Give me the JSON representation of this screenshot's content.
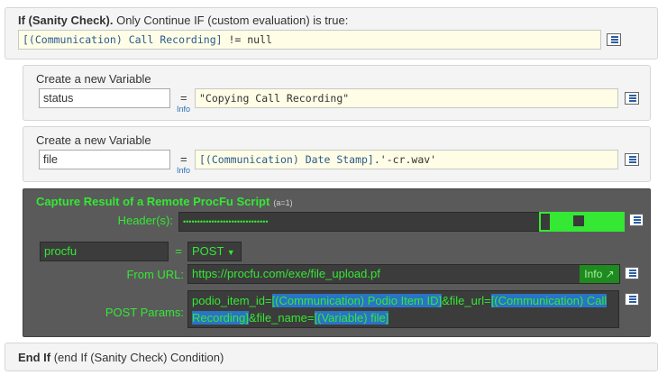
{
  "sanity_check": {
    "title_bold": "If (Sanity Check).",
    "title_rest": " Only Continue IF (custom evaluation) is true:",
    "expression_var": "[(Communication) Call Recording]",
    "expression_rest": " != null"
  },
  "var1": {
    "title": "Create a new Variable",
    "name": "status",
    "eq": "=",
    "info": "Info",
    "value": "\"Copying Call Recording\""
  },
  "var2": {
    "title": "Create a new Variable",
    "name": "file",
    "eq": "=",
    "info": "Info",
    "value_var": "[(Communication) Date Stamp]",
    "value_rest": ".'-cr.wav'"
  },
  "capture": {
    "title": "Capture Result of a Remote ProcFu Script",
    "badge": "(a=1)",
    "headers_label": "Header(s):",
    "headers_value": "••••••••••••••••••••••••••••••",
    "result_var": "procfu",
    "eq": "=",
    "method": "POST",
    "method_arrow": "▼",
    "url_label": "From URL:",
    "url_value": "https://procfu.com/exe/file_upload.pf",
    "url_info": "Info ↗",
    "params_label": "POST Params:",
    "params": {
      "p1": "podio_item_id=",
      "v1": "[(Communication) Podio Item ID]",
      "p2": "&file_url=",
      "v2a": "[(Communication) Call",
      "v2b": "Recording]",
      "p3": "&file_name=",
      "v3": "[(Variable) file]"
    }
  },
  "end_if": {
    "title_bold": "End If",
    "title_rest": " (end If (Sanity Check) Condition)"
  },
  "colors": {
    "accent_green": "#34e834",
    "highlight_blue": "#2a73c5",
    "dark_panel": "#5a5a5a"
  }
}
